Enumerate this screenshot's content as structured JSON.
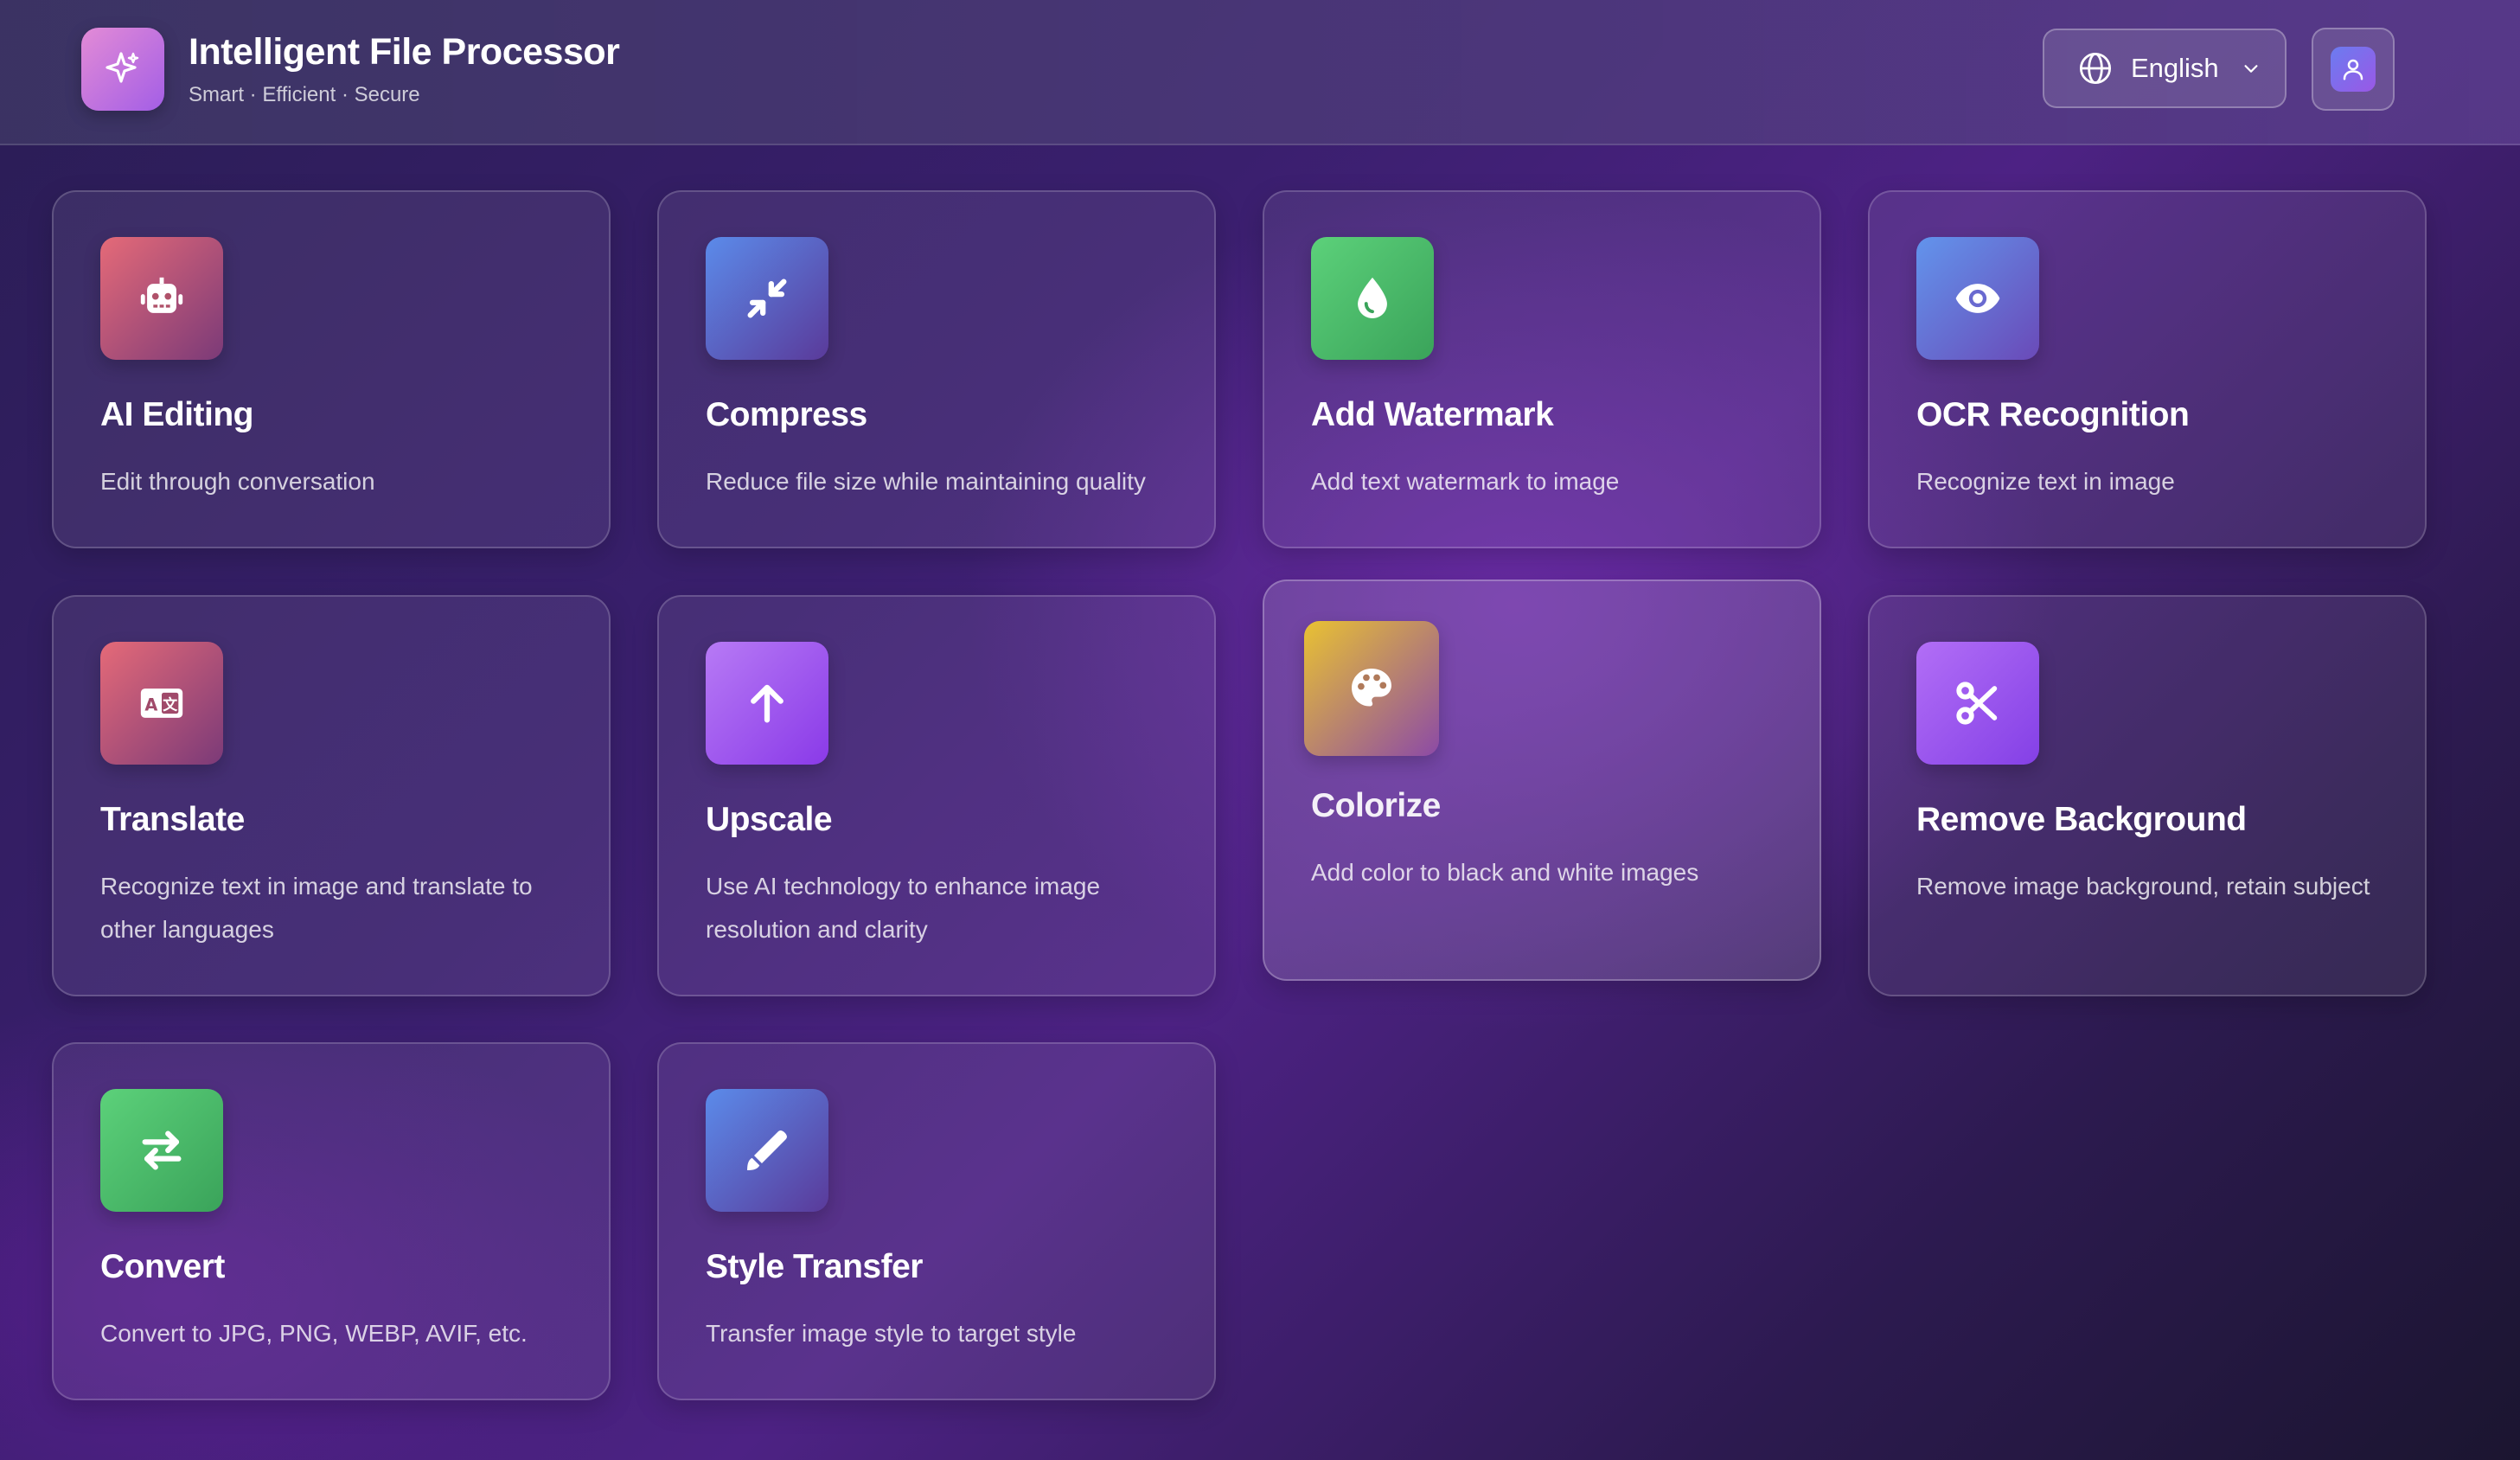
{
  "header": {
    "title": "Intelligent File Processor",
    "subtitle": "Smart · Efficient · Secure",
    "logo_icon": "sparkles-icon",
    "language_label": "English",
    "user_icon": "user-icon"
  },
  "tools": [
    {
      "title": "AI Editing",
      "desc": "Edit through conversation",
      "icon": "robot-icon",
      "color": "#e56a78"
    },
    {
      "title": "Compress",
      "desc": "Reduce file size while maintaining quality",
      "icon": "compress-arrows-icon",
      "color": "#5b8bea"
    },
    {
      "title": "Add Watermark",
      "desc": "Add text watermark to image",
      "icon": "droplet-icon",
      "color": "#5cd17a"
    },
    {
      "title": "OCR Recognition",
      "desc": "Recognize text in image",
      "icon": "eye-icon",
      "color": "#6294ec"
    },
    {
      "title": "Translate",
      "desc": "Recognize text in image and translate to other languages",
      "icon": "language-icon",
      "color": "#e56a78"
    },
    {
      "title": "Upscale",
      "desc": "Use AI technology to enhance image resolution and clarity",
      "icon": "arrow-up-icon",
      "color": "#b77af5"
    },
    {
      "title": "Colorize",
      "desc": "Add color to black and white images",
      "icon": "palette-icon",
      "color": "#e9c232"
    },
    {
      "title": "Remove Background",
      "desc": "Remove image background, retain subject",
      "icon": "scissors-icon",
      "color": "#b26ef6"
    },
    {
      "title": "Convert",
      "desc": "Convert to JPG, PNG, WEBP, AVIF, etc.",
      "icon": "swap-arrows-icon",
      "color": "#5cd17a"
    },
    {
      "title": "Style Transfer",
      "desc": "Transfer image style to target style",
      "icon": "brush-icon",
      "color": "#5b8bea"
    }
  ]
}
